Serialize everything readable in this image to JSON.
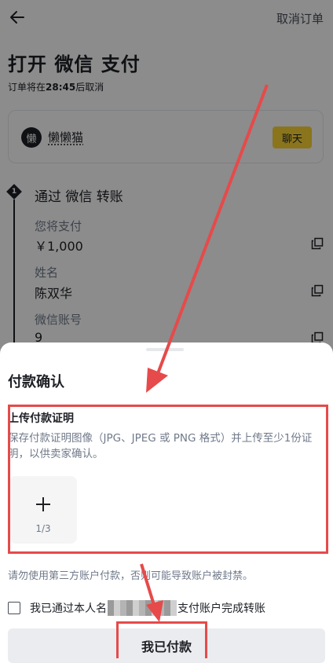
{
  "header": {
    "cancel_order_label": "取消订单"
  },
  "page": {
    "title": "打开 微信 支付",
    "countdown_prefix": "订单将在",
    "countdown_time": "28:45",
    "countdown_suffix": "后取消"
  },
  "seller": {
    "avatar_char": "懒",
    "name": "懒懒猫",
    "chat_label": "聊天"
  },
  "step": {
    "number": "1",
    "title": "通过 微信 转账",
    "fields": [
      {
        "label": "您将支付",
        "value": "￥1,000"
      },
      {
        "label": "姓名",
        "value": "陈双华"
      },
      {
        "label": "微信账号",
        "value": "9"
      }
    ]
  },
  "sheet": {
    "title": "付款确认",
    "upload_title": "上传付款证明",
    "upload_desc": "保存付款证明图像（JPG、JPEG 或 PNG 格式）并上传至少1份证明，以供卖家确认。",
    "upload_count": "1/3",
    "warning": "请勿使用第三方账户付款，否则可能导致账户被封禁。",
    "confirm_prefix": "我已通过本人名",
    "confirm_suffix": "支付账户完成转账",
    "pay_button_label": "我已付款"
  },
  "colors": {
    "accent": "#fcd535",
    "annotation": "#e64a4a"
  }
}
